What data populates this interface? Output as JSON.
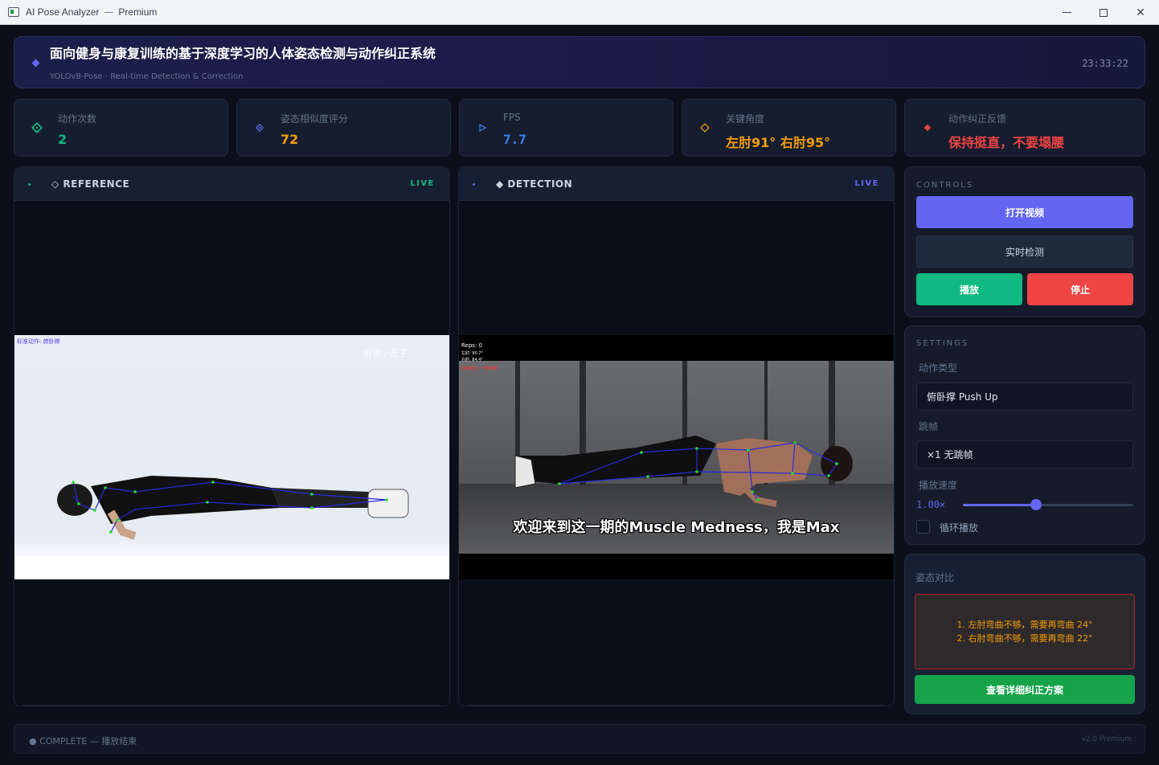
{
  "window": {
    "title": "AI Pose Analyzer",
    "separator": "—",
    "edition": "Premium"
  },
  "header": {
    "title": "面向健身与康复训练的基于深度学习的人体姿态检测与动作纠正系统",
    "subtitle": "YOLOv8-Pose · Real-time Detection & Correction",
    "time": "23:33:22"
  },
  "stats": {
    "reps": {
      "label": "动作次数",
      "value": "2",
      "color": "#10b981"
    },
    "similarity": {
      "label": "姿态相似度评分",
      "value": "72",
      "color": "#f59e0b"
    },
    "fps": {
      "label": "FPS",
      "value": "7.7",
      "color": "#3b82f6"
    },
    "angles": {
      "label": "关键角度",
      "value": "左肘91°  右肘95°",
      "color": "#f59e0b"
    },
    "feedback": {
      "label": "动作纠正反馈",
      "value": "保持挺直，不要塌腰",
      "color": "#ef4444"
    }
  },
  "reference_panel": {
    "title": "◇ REFERENCE",
    "live": "LIVE",
    "overlay_label": "标准动作: 俯卧撑",
    "watermark": "俯读小王子"
  },
  "detection_panel": {
    "title": "◆ DETECTION",
    "live": "LIVE",
    "overlay_reps": "Reps: 0",
    "overlay_left": "左肘: 90.7°",
    "overlay_right": "右肘: 84.4°",
    "overlay_warning": "保持挺直，不要塌腰",
    "subtitle": "欢迎来到这一期的Muscle Medness，我是Max"
  },
  "controls": {
    "caption": "CONTROLS",
    "open_video": "打开视频",
    "realtime": "实时检测",
    "play": "播放",
    "stop": "停止"
  },
  "settings": {
    "caption": "SETTINGS",
    "action_label": "动作类型",
    "action_value": "俯卧撑  Push Up",
    "skip_label": "跳帧",
    "skip_value": "×1  无跳帧",
    "speed_label": "播放速度",
    "speed_value": "1.00×",
    "speed_fraction": 0.43,
    "loop_label": "循环播放",
    "loop_checked": false
  },
  "comparison": {
    "caption": "姿态对比",
    "line1": "1. 左肘弯曲不够，需要再弯曲 24°",
    "line2": "2. 右肘弯曲不够，需要再弯曲 22°",
    "detail_button": "查看详细纠正方案"
  },
  "footer": {
    "status": "● COMPLETE  —  播放结束",
    "version": "v2.0  Premium"
  },
  "colors": {
    "accent": "#6366f1",
    "green": "#10b981",
    "red": "#ef4444",
    "amber": "#f59e0b",
    "blue": "#3b82f6"
  }
}
